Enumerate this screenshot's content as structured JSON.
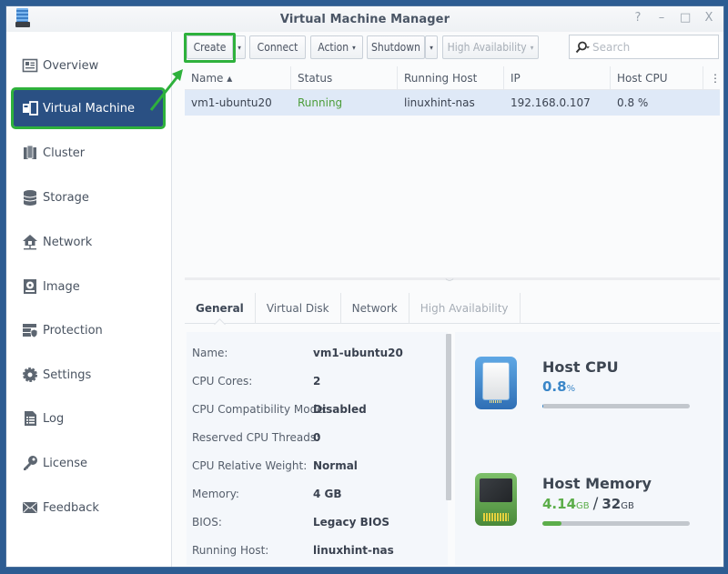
{
  "window": {
    "title": "Virtual Machine Manager",
    "controls": [
      {
        "name": "help",
        "glyph": "?"
      },
      {
        "name": "minimize",
        "glyph": "–"
      },
      {
        "name": "maximize",
        "glyph": "□"
      },
      {
        "name": "close",
        "glyph": "X"
      }
    ]
  },
  "sidebar": {
    "items": [
      {
        "label": "Overview",
        "icon": "overview-icon"
      },
      {
        "label": "Virtual Machine",
        "icon": "virtual-machine-icon",
        "active": true
      },
      {
        "label": "Cluster",
        "icon": "cluster-icon"
      },
      {
        "label": "Storage",
        "icon": "storage-icon"
      },
      {
        "label": "Network",
        "icon": "network-icon"
      },
      {
        "label": "Image",
        "icon": "image-icon"
      },
      {
        "label": "Protection",
        "icon": "protection-icon"
      },
      {
        "label": "Settings",
        "icon": "settings-icon"
      },
      {
        "label": "Log",
        "icon": "log-icon"
      },
      {
        "label": "License",
        "icon": "license-icon"
      },
      {
        "label": "Feedback",
        "icon": "feedback-icon"
      }
    ]
  },
  "toolbar": {
    "create": "Create",
    "connect": "Connect",
    "action": "Action",
    "shutdown": "Shutdown",
    "high_availability": "High Availability",
    "caret": "▾",
    "search_placeholder": "Search"
  },
  "grid": {
    "columns": [
      "Name ▴",
      "Status",
      "Running Host",
      "IP",
      "Host CPU",
      "⋮"
    ],
    "rows": [
      {
        "name": "vm1-ubuntu20",
        "status": "Running",
        "running_host": "linuxhint-nas",
        "ip": "192.168.0.107",
        "host_cpu": "0.8 %"
      }
    ]
  },
  "detail_tabs": [
    {
      "label": "General",
      "active": true
    },
    {
      "label": "Virtual Disk"
    },
    {
      "label": "Network"
    },
    {
      "label": "High Availability",
      "disabled": true
    }
  ],
  "general": [
    {
      "label": "Name:",
      "value": "vm1-ubuntu20"
    },
    {
      "label": "CPU Cores:",
      "value": "2"
    },
    {
      "label": "CPU Compatibility Mode:",
      "value": "Disabled"
    },
    {
      "label": "Reserved CPU Threads:",
      "value": "0"
    },
    {
      "label": "CPU Relative Weight:",
      "value": "Normal"
    },
    {
      "label": "Memory:",
      "value": "4 GB"
    },
    {
      "label": "BIOS:",
      "value": "Legacy BIOS"
    },
    {
      "label": "Running Host:",
      "value": "linuxhint-nas"
    }
  ],
  "stats": {
    "cpu": {
      "title": "Host CPU",
      "value": "0.8",
      "unit": "%",
      "percent": 0.8,
      "color": "#3a86c8"
    },
    "memory": {
      "title": "Host Memory",
      "used": "4.14",
      "used_unit": "GB",
      "separator": "/",
      "total": "32",
      "total_unit": "GB",
      "percent": 12.9,
      "color": "#5cae4a"
    }
  },
  "colors": {
    "highlight_green": "#2eb13c",
    "sidebar_active": "#2a5083",
    "selected_row": "#dfe9f7",
    "running_status": "#4c9d3a"
  }
}
